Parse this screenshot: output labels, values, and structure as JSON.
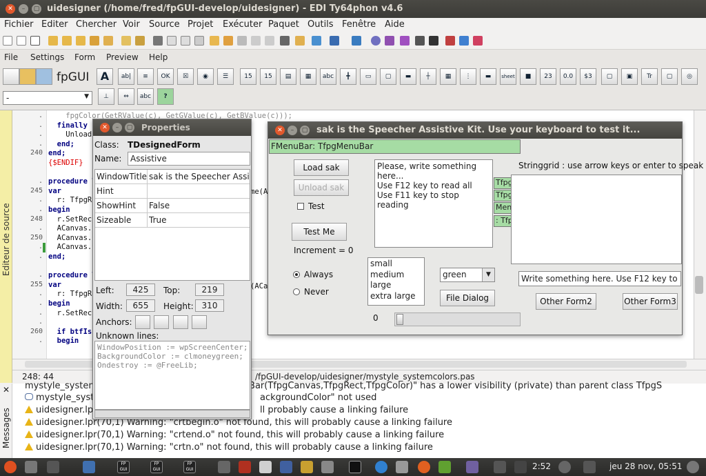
{
  "window": {
    "title": "uidesigner (/home/fred/fpGUI-develop/uidesigner) - EDI Ty64phon v4.6"
  },
  "ide_menu": [
    "Fichier",
    "Editer",
    "Chercher",
    "Voir",
    "Source",
    "Projet",
    "Exécuter",
    "Paquet",
    "Outils",
    "Fenêtre",
    "Aide"
  ],
  "designer_menu": [
    "File",
    "Settings",
    "Form",
    "Preview",
    "Help"
  ],
  "designer_toolbar": {
    "logo": "fpGUI",
    "widget_combo": "-"
  },
  "editor": {
    "side_label": "Editeur de source",
    "gutter": [
      {
        "n": "",
        "mark": "."
      },
      {
        "n": "",
        "mark": "."
      },
      {
        "n": "",
        "mark": "."
      },
      {
        "n": "",
        "mark": "."
      },
      {
        "n": "240",
        "mark": "."
      },
      {
        "n": "",
        "mark": ""
      },
      {
        "n": "",
        "mark": ""
      },
      {
        "n": "",
        "mark": "."
      },
      {
        "n": "245",
        "mark": "."
      },
      {
        "n": "",
        "mark": "."
      },
      {
        "n": "",
        "mark": "."
      },
      {
        "n": "248",
        "mark": "."
      },
      {
        "n": "",
        "mark": "."
      },
      {
        "n": "250",
        "mark": "."
      },
      {
        "n": "",
        "mark": "."
      },
      {
        "n": "",
        "mark": "."
      },
      {
        "n": "",
        "mark": ""
      },
      {
        "n": "",
        "mark": "."
      },
      {
        "n": "255",
        "mark": "."
      },
      {
        "n": "",
        "mark": "."
      },
      {
        "n": "",
        "mark": "."
      },
      {
        "n": "",
        "mark": "."
      },
      {
        "n": "",
        "mark": "."
      },
      {
        "n": "260",
        "mark": "."
      },
      {
        "n": "",
        "mark": "."
      }
    ],
    "lines": [
      "    fpgColor(GetRValue(c), GetGValue(c), GetBValue(c)));",
      "  finally",
      "    Unload",
      "  end;",
      "end;",
      "{$ENDIF}",
      "",
      "procedure T",
      "var",
      "  r: TfpgRe",
      "begin",
      "  r.SetRect",
      "  ACanvas.S",
      "  ACanvas.C",
      "  ACanvas.S",
      "end;",
      "",
      "procedure T",
      "var",
      "  r: TfpgRe",
      "begin",
      "  r.SetRect",
      "",
      "  if btfIs",
      "  begin"
    ],
    "fragments": [
      "me(A",
      "(ACa"
    ],
    "status_pos": "248: 44",
    "status_file": "/fpGUI-develop/uidesigner/mystyle_systemcolors.pas"
  },
  "messages": {
    "side_label": "Messages",
    "lines": [
      {
        "icon": "none",
        "text": "mystyle_systemcolors.pas(73,1) Hint: \"DrawMenuBar(TfpgCanvas,TfpgRect,TfpgColor)\" has a lower visibility (private) than parent class TfpgS"
      },
      {
        "icon": "hint",
        "text": "mystyle_system",
        "tail": "ackgroundColor\" not used"
      },
      {
        "icon": "warn",
        "text": "uidesigner.lpr(70",
        "tail": "ll probably cause a linking failure"
      },
      {
        "icon": "warn",
        "text": "uidesigner.lpr(70,1) Warning: \"crtbegin.o\" not found, this will probably cause a linking failure"
      },
      {
        "icon": "warn",
        "text": "uidesigner.lpr(70,1) Warning: \"crtend.o\" not found, this will probably cause a linking failure"
      },
      {
        "icon": "warn",
        "text": "uidesigner.lpr(70,1) Warning: \"crtn.o\" not found, this will probably cause a linking failure"
      }
    ]
  },
  "properties": {
    "title": "Properties",
    "class_label": "Class:",
    "class_value": "TDesignedForm",
    "name_label": "Name:",
    "name_value": "Assistive",
    "rows": [
      {
        "key": "WindowTitle",
        "value": "sak is the Speecher Assistive Kit"
      },
      {
        "key": "Hint",
        "value": ""
      },
      {
        "key": "ShowHint",
        "value": "False"
      },
      {
        "key": "Sizeable",
        "value": "True"
      }
    ],
    "left_label": "Left:",
    "left": "425",
    "top_label": "Top:",
    "top": "219",
    "width_label": "Width:",
    "width": "655",
    "height_label": "Height:",
    "height": "310",
    "anchors_label": "Anchors:",
    "unknown_label": "Unknown lines:",
    "unknown_lines": "WindowPosition := wpScreenCenter;\nBackgroundColor := clmoneygreen;\nOndestroy := @FreeLib;"
  },
  "designer": {
    "title": "sak is the Speecher Assistive Kit. Use your keyboard to test it...",
    "menubar_label": "FMenuBar: TfpgMenuBar",
    "load": "Load sak",
    "unload": "Unload sak",
    "test_check": "Test",
    "test_me": "Test Me",
    "increment": "Increment = 0",
    "memo": [
      "Please, write something here...",
      "Use F12 key to read all",
      "Use F11 key to stop reading"
    ],
    "stringgrid_label": "Stringgrid : use arrow keys or enter to speak",
    "radio_always": "Always",
    "radio_never": "Never",
    "listbox": [
      "small",
      "medium",
      "large",
      "extra large"
    ],
    "combo": "green",
    "file_dialog": "File Dialog",
    "edit": "Write something here. Use F12 key to read",
    "other2": "Other Form2",
    "other3": "Other Form3",
    "trackbar_value": "0",
    "trackbar_position": 0,
    "hidden_labels": [
      "Tfpg",
      "Tfpg",
      "MenuB",
      ": Tfp"
    ]
  },
  "taskbar": {
    "time": "2:52",
    "clock": "jeu 28 nov, 05:51",
    "items": [
      "FP GUI",
      "FP GUI",
      "FP GUI"
    ]
  },
  "colors": {
    "green_widget": "#a6dca4",
    "sidebar": "#f4eea6",
    "close": "#e1582c"
  }
}
